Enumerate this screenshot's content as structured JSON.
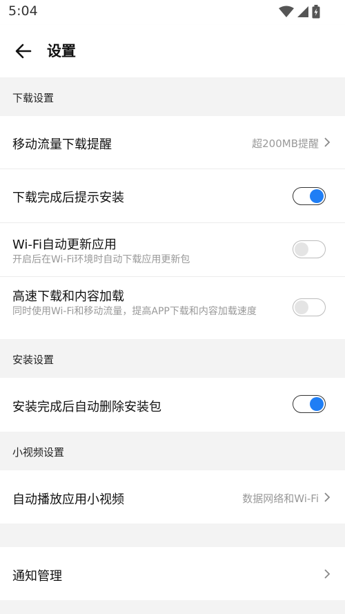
{
  "status": {
    "time": "5:04"
  },
  "header": {
    "title": "设置"
  },
  "sections": {
    "download": "下载设置",
    "install": "安装设置",
    "video": "小视频设置"
  },
  "rows": {
    "mobile_data_reminder": {
      "label": "移动流量下载提醒",
      "value": "超200MB提醒"
    },
    "install_prompt": {
      "label": "下载完成后提示安装",
      "toggle": true
    },
    "wifi_auto_update": {
      "label": "Wi-Fi自动更新应用",
      "sub": "开启后在Wi-Fi环境时自动下载应用更新包",
      "toggle": false
    },
    "high_speed": {
      "label": "高速下载和内容加载",
      "sub": "同时使用Wi-Fi和移动流量，提高APP下载和内容加载速度",
      "toggle": false
    },
    "auto_delete": {
      "label": "安装完成后自动删除安装包",
      "toggle": true
    },
    "autoplay_video": {
      "label": "自动播放应用小视频",
      "value": "数据网络和Wi-Fi"
    },
    "notifications": {
      "label": "通知管理"
    }
  },
  "colors": {
    "accent": "#1f7ef5",
    "background": "#f3f3f3"
  },
  "icons": [
    "back-arrow-icon",
    "wifi-icon",
    "signal-icon",
    "battery-icon",
    "chevron-right-icon"
  ]
}
